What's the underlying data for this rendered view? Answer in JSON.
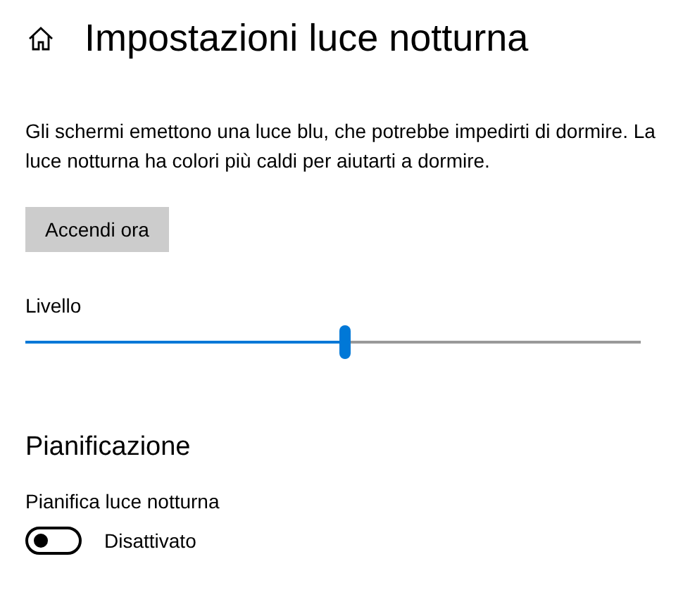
{
  "header": {
    "title": "Impostazioni luce notturna"
  },
  "description": "Gli schermi emettono una luce blu, che potrebbe impedirti di dormire. La luce notturna ha colori più caldi per aiutarti a dormire.",
  "action_button": "Accendi ora",
  "strength": {
    "label": "Livello",
    "level": 0.52
  },
  "schedule": {
    "heading": "Pianificazione",
    "label": "Pianifica luce notturna",
    "on": false,
    "state_text": "Disattivato"
  }
}
